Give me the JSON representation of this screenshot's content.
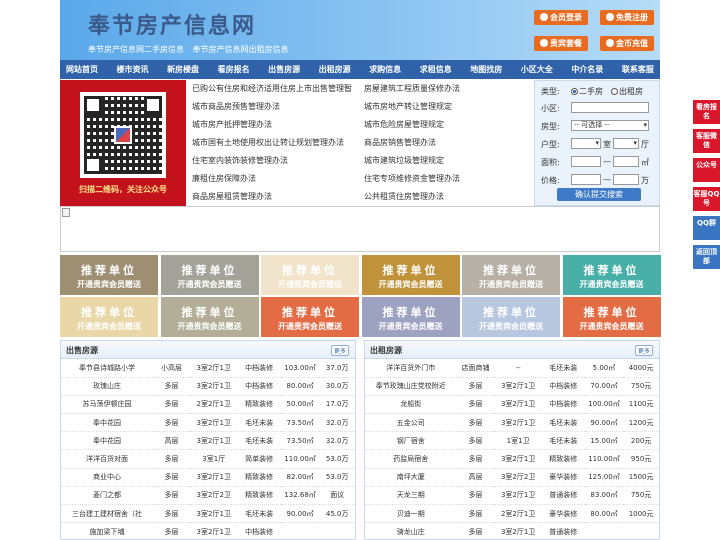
{
  "header": {
    "title": "奉节房产信息网",
    "subtitles": [
      "奉节房产信息网二手房信息",
      "奉节房产信息网出租房信息"
    ],
    "buttons": [
      "会员登录",
      "免费注册",
      "贵宾套餐",
      "金币充值"
    ]
  },
  "nav": [
    "网站首页",
    "楼市资讯",
    "新房楼盘",
    "看房报名",
    "出售房源",
    "出租房源",
    "求购信息",
    "求租信息",
    "地图找房",
    "小区大全",
    "中介名录",
    "联系客服"
  ],
  "qr": {
    "caption": "扫描二维码，关注公众号"
  },
  "links": {
    "col1": [
      "已购公有住房和经济适用住房上市出售管理暂",
      "城市商品房预售管理办法",
      "城市房产抵押管理办法",
      "城市国有土地使用权出让转让规划管理办法",
      "住宅室内装饰装修管理办法",
      "廉租住房保障办法",
      "商品房屋租赁管理办法"
    ],
    "col2": [
      "房屋建筑工程质量保修办法",
      "城市房地产转让管理规定",
      "城市危险房屋管理规定",
      "商品房销售管理办法",
      "城市建筑垃圾管理规定",
      "住宅专项维修资金管理办法",
      "公共租赁住房管理办法"
    ]
  },
  "search": {
    "type_label": "类型:",
    "opt1": "二手房",
    "opt2": "出租房",
    "area_label": "小区:",
    "house_label": "房型:",
    "house_select": "-- 可选择 --",
    "layout_label": "户型:",
    "room": "室",
    "hall": "厅",
    "size_label": "面积:",
    "size_unit": "㎡",
    "price_label": "价格:",
    "price_unit": "万",
    "submit": "确认提交搜索"
  },
  "ads": {
    "title": "推荐单位",
    "sub": "开通贵宾会员赠送"
  },
  "colors": {
    "ads": [
      "#9e8f73",
      "#a4a39a",
      "#f2e4cb",
      "#c0923a",
      "#b7b0a6",
      "#47afa6",
      "#ead7a8",
      "#b2ae98",
      "#e46c45",
      "#9da2c0",
      "#b8c7e0",
      "#e46c45"
    ]
  },
  "sale": {
    "title": "出售房源",
    "more": "更多",
    "rows": [
      [
        "奉节县诗城路小学",
        "小高层",
        "3室2厅1卫",
        "中档装修",
        "103.00㎡",
        "37.0万"
      ],
      [
        "玫瑰山庄",
        "多层",
        "3室2厅1卫",
        "中档装修",
        "80.00㎡",
        "30.0万"
      ],
      [
        "苏马荡伊顿庄园",
        "多层",
        "2室2厅1卫",
        "精致装修",
        "50.00㎡",
        "17.0万"
      ],
      [
        "奉中花园",
        "多层",
        "3室2厅1卫",
        "毛坯未装",
        "73.50㎡",
        "32.0万"
      ],
      [
        "奉中花园",
        "高层",
        "3室2厅1卫",
        "毛坯未装",
        "73.50㎡",
        "32.0万"
      ],
      [
        "洋洋百货对面",
        "多层",
        "3室1厅",
        "简单装修",
        "110.00㎡",
        "53.0万"
      ],
      [
        "商业中心",
        "多层",
        "3室2厅1卫",
        "精致装修",
        "82.00㎡",
        "53.0万"
      ],
      [
        "菱门之都",
        "多层",
        "3室2厅2卫",
        "精致装修",
        "132.68㎡",
        "面议"
      ],
      [
        "三台建工建材宿舍（社",
        "多层",
        "3室2厅1卫",
        "毛坯未装",
        "90.00㎡",
        "45.0万"
      ],
      [
        "施加梁下埔",
        "多层",
        "3室2厅1卫",
        "中档装修",
        "",
        ""
      ]
    ]
  },
  "rent": {
    "title": "出租房源",
    "more": "更多",
    "rows": [
      [
        "洋洋百货外门市",
        "店面商铺",
        "--",
        "毛坯未装",
        "5.00㎡",
        "4000元"
      ],
      [
        "奉节玫瑰山庄党校附近",
        "多层",
        "3室2厅1卫",
        "中档装修",
        "70.00㎡",
        "750元"
      ],
      [
        "龙船街",
        "多层",
        "3室2厅1卫",
        "中档装修",
        "100.00㎡",
        "1100元"
      ],
      [
        "五金公司",
        "多层",
        "3室2厅1卫",
        "毛坯未装",
        "90.00㎡",
        "1200元"
      ],
      [
        "钢厂宿舍",
        "多层",
        "1室1卫",
        "毛坯未装",
        "15.00㎡",
        "200元"
      ],
      [
        "药监局宿舍",
        "多层",
        "3室2厅1卫",
        "精致装修",
        "110.00㎡",
        "950元"
      ],
      [
        "南坪大厦",
        "高层",
        "3室2厅2卫",
        "豪华装修",
        "125.00㎡",
        "1500元"
      ],
      [
        "天龙三期",
        "多层",
        "3室2厅1卫",
        "普通装修",
        "83.00㎡",
        "750元"
      ],
      [
        "贝迪一期",
        "多层",
        "2室2厅1卫",
        "豪华装修",
        "80.00㎡",
        "1000元"
      ],
      [
        "骑龙山庄",
        "多层",
        "3室2厅1卫",
        "普通装修",
        "",
        ""
      ]
    ]
  },
  "side": [
    "看房报名",
    "客服微信",
    "公众号",
    "客服QQ号",
    "QQ群",
    "返回顶部"
  ]
}
